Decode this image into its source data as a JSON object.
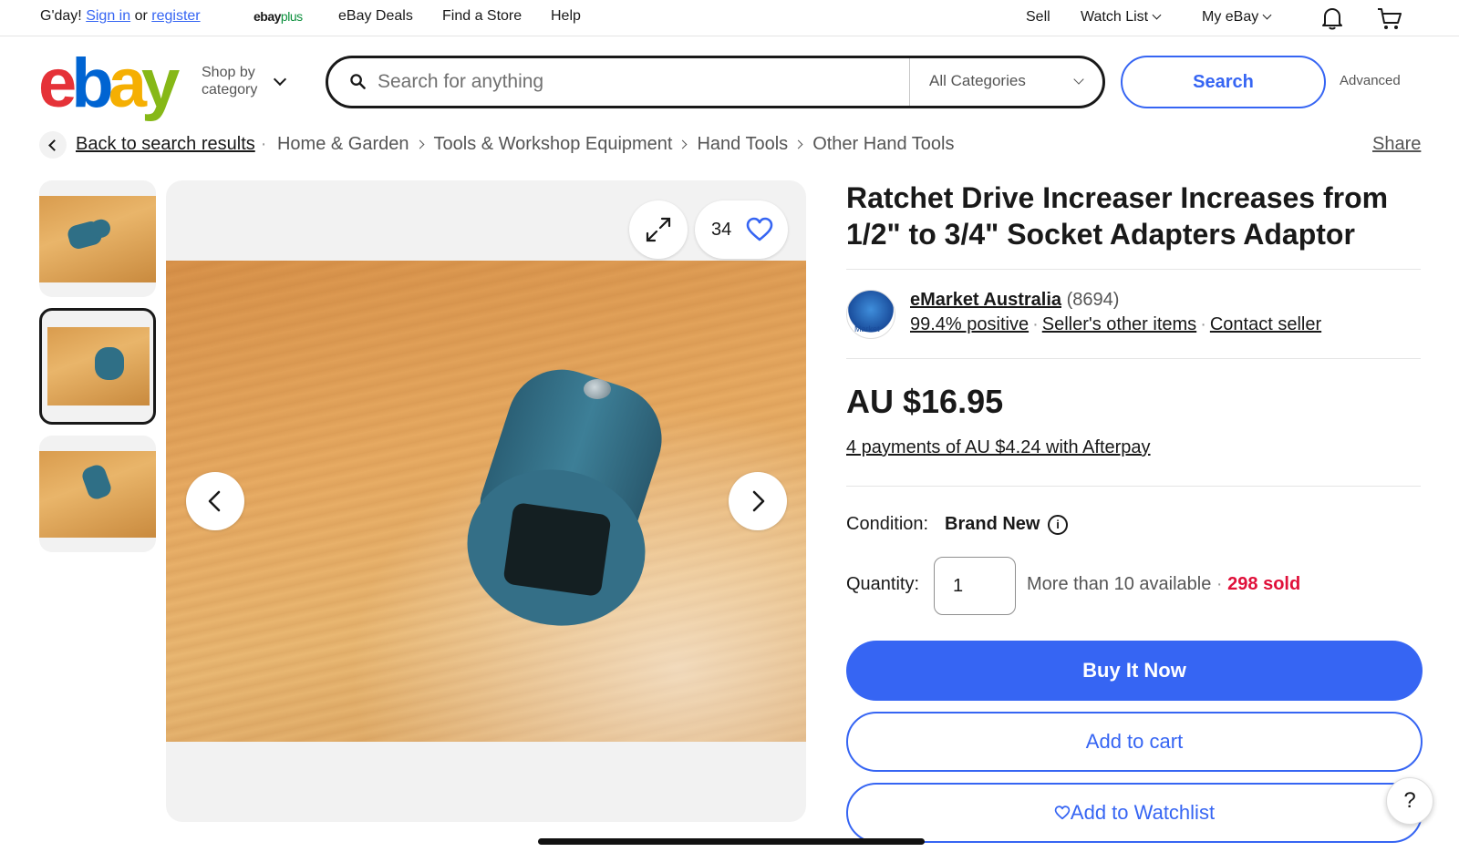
{
  "topbar": {
    "greeting": "G'day!",
    "sign_in": "Sign in",
    "or": "or",
    "register": "register",
    "ebayplus_1": "ebay",
    "ebayplus_2": "plus",
    "nav": [
      "eBay Deals",
      "Find a Store",
      "Help"
    ],
    "sell": "Sell",
    "watch_list": "Watch List",
    "my_ebay": "My eBay",
    "bell_icon": "bell-icon",
    "cart_icon": "cart-icon"
  },
  "header": {
    "logo": [
      "e",
      "b",
      "a",
      "y"
    ],
    "shop_by_1": "Shop by",
    "shop_by_2": "category",
    "search_placeholder": "Search for anything",
    "category_select": "All Categories",
    "search_button": "Search",
    "advanced": "Advanced"
  },
  "breadcrumb": {
    "back": "Back to search results",
    "items": [
      "Home & Garden",
      "Tools & Workshop Equipment",
      "Hand Tools",
      "Other Hand Tools"
    ],
    "share": "Share"
  },
  "gallery": {
    "like_count": "34",
    "thumbnails": 3,
    "selected_thumbnail": 2
  },
  "product": {
    "title": "Ratchet Drive Increaser Increases from 1/2\" to 3/4\" Socket Adapters Adaptor",
    "seller_name": "eMarket Australia",
    "seller_feedback": "(8694)",
    "seller_avatar_text": "Market",
    "positive": "99.4% positive",
    "other_items": "Seller's other items",
    "contact": "Contact seller",
    "price": "AU $16.95",
    "afterpay": "4 payments of AU $4.24 with Afterpay",
    "condition_label": "Condition:",
    "condition_value": "Brand New",
    "quantity_label": "Quantity:",
    "quantity_value": "1",
    "available": "More than 10 available",
    "sold": "298 sold",
    "buy_now": "Buy It Now",
    "add_to_cart": "Add to cart",
    "add_to_watchlist": "Add to Watchlist",
    "help": "?"
  },
  "colors": {
    "accent": "#3665f3",
    "sold": "#e0103a",
    "logo_e": "#e53238",
    "logo_b": "#0064d2",
    "logo_a": "#f5af02",
    "logo_y": "#86b817"
  }
}
